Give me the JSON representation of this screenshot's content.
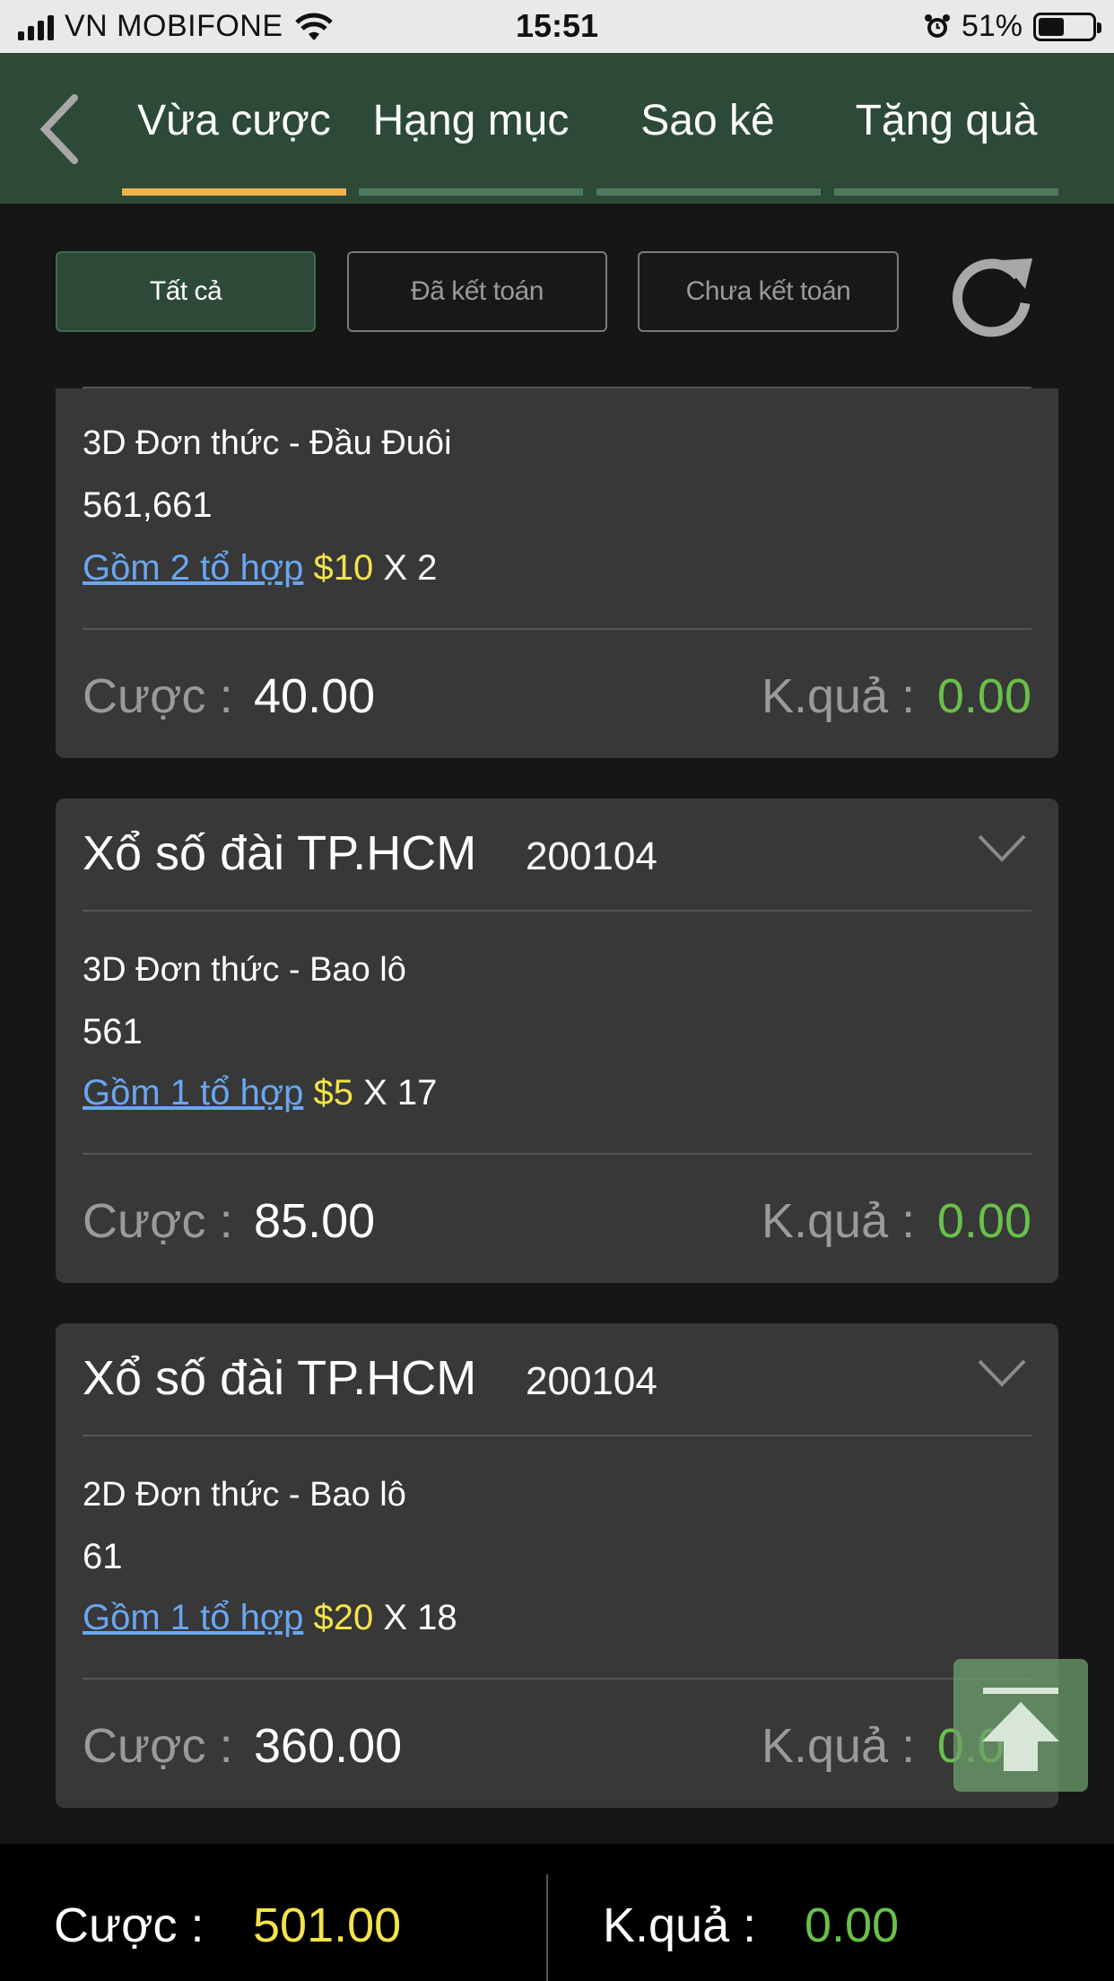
{
  "status_bar": {
    "carrier": "VN MOBIFONE",
    "time": "15:51",
    "battery": "51%"
  },
  "tabs": [
    {
      "label": "Vừa cược",
      "active": true
    },
    {
      "label": "Hạng mục",
      "active": false
    },
    {
      "label": "Sao kê",
      "active": false
    },
    {
      "label": "Tặng quà",
      "active": false
    }
  ],
  "filters": [
    {
      "label": "Tất cả",
      "active": true
    },
    {
      "label": "Đã kết toán",
      "active": false
    },
    {
      "label": "Chưa kết toán",
      "active": false
    }
  ],
  "cards": [
    {
      "title": "",
      "draw": "",
      "bet_type": "3D Đơn thức - Đầu Đuôi",
      "numbers": "561,661",
      "combo_link": "Gồm 2 tổ hợp",
      "combo_price": "$10",
      "combo_mult": " X 2",
      "stake_label": "Cược",
      "stake_value": "40.00",
      "result_label": "K.quả",
      "result_value": "0.00"
    },
    {
      "title": "Xổ số đài TP.HCM",
      "draw": "200104",
      "bet_type": "3D Đơn thức - Bao lô",
      "numbers": "561",
      "combo_link": "Gồm 1 tổ hợp",
      "combo_price": "$5",
      "combo_mult": " X 17",
      "stake_label": "Cược",
      "stake_value": "85.00",
      "result_label": "K.quả",
      "result_value": "0.00"
    },
    {
      "title": "Xổ số đài TP.HCM",
      "draw": "200104",
      "bet_type": "2D Đơn thức - Bao lô",
      "numbers": "61",
      "combo_link": "Gồm 1 tổ hợp",
      "combo_price": "$20",
      "combo_mult": " X 18",
      "stake_label": "Cược",
      "stake_value": "360.00",
      "result_label": "K.quả",
      "result_value": "0.00"
    }
  ],
  "footer": {
    "stake_label": "Cược :",
    "stake_value": "501.00",
    "result_label": "K.quả :",
    "result_value": "0.00"
  },
  "colors": {
    "header_green": "#2d4a38",
    "active_tab_underline": "#f0b34a",
    "link_blue": "#6aa6f0",
    "price_yellow": "#f4e34a",
    "result_green": "#6ac04a"
  }
}
